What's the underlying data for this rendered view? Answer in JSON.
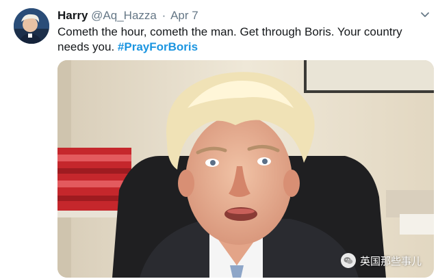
{
  "tweet": {
    "author_name": "Harry",
    "author_handle": "@Aq_Hazza",
    "separator": "·",
    "date": "Apr 7",
    "text": "Cometh the hour, cometh the man. Get through Boris. Your country needs you.",
    "hashtag": "#PrayForBoris",
    "avatar_icon": "user-avatar",
    "menu_icon": "chevron-down-icon"
  },
  "watermark": {
    "text": "英国那些事儿",
    "icon": "wechat-icon"
  },
  "colors": {
    "link": "#1b95e0",
    "muted": "#657786",
    "text": "#14171a"
  }
}
